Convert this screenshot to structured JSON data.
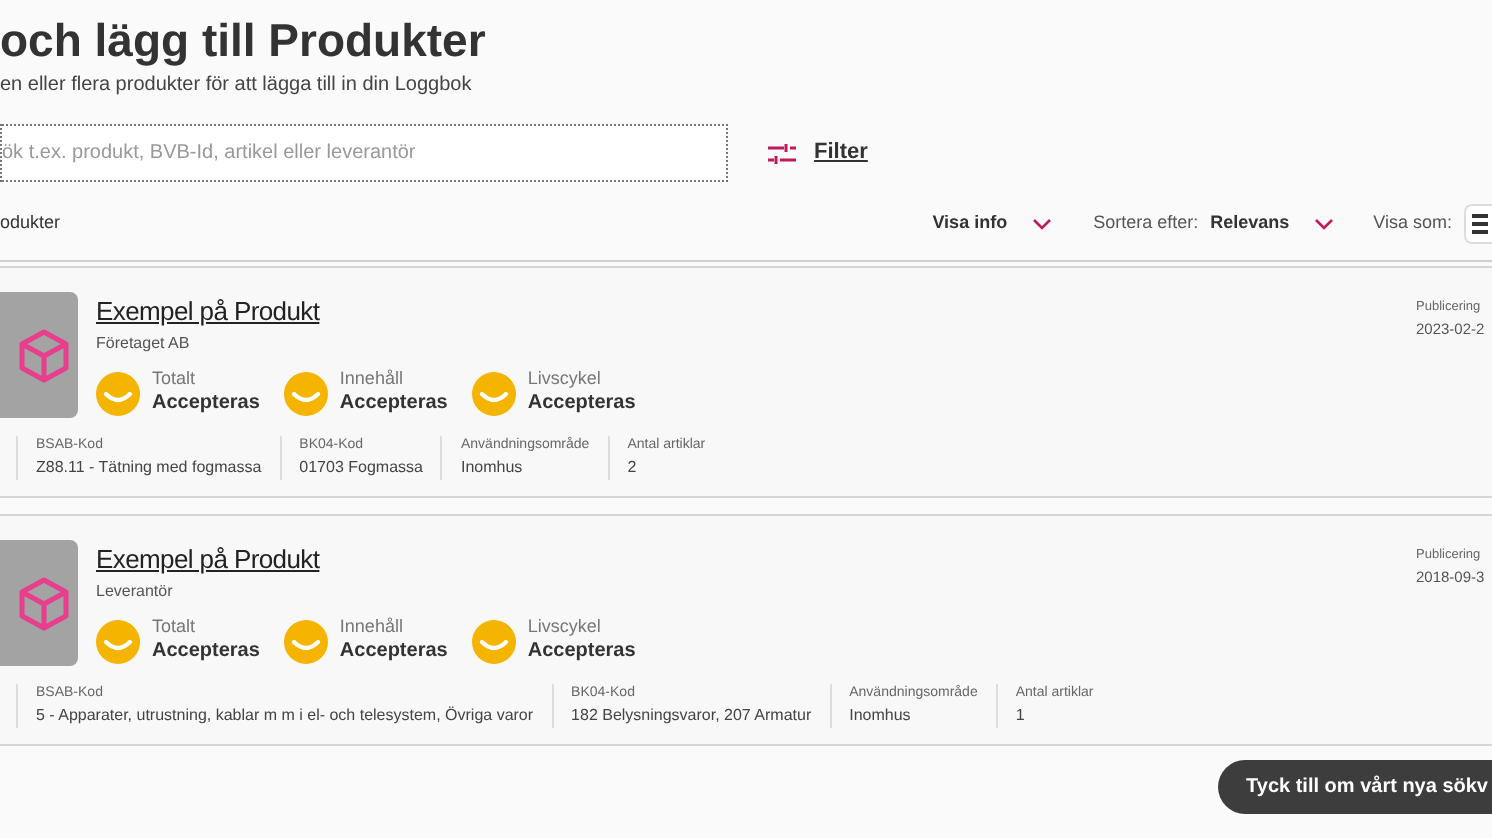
{
  "header": {
    "title": "och lägg till Produkter",
    "subtitle": "en eller flera produkter för att lägga till in din Loggbok"
  },
  "search": {
    "placeholder": "ök t.ex. produkt, BVB-Id, artikel eller leverantör",
    "filter_label": "Filter"
  },
  "toolbar": {
    "count_label": "odukter",
    "visa_info": "Visa info",
    "sort_label": "Sortera efter:",
    "sort_value": "Relevans",
    "view_label": "Visa som:"
  },
  "products": [
    {
      "name": "Exempel på Produkt",
      "supplier": "Företaget AB",
      "published_label": "Publicering",
      "published_date": "2023-02-2",
      "ratings": [
        {
          "label": "Totalt",
          "value": "Accepteras"
        },
        {
          "label": "Innehåll",
          "value": "Accepteras"
        },
        {
          "label": "Livscykel",
          "value": "Accepteras"
        }
      ],
      "fields": [
        {
          "label": "BSAB-Kod",
          "value": "Z88.11 - Tätning med fogmassa"
        },
        {
          "label": "BK04-Kod",
          "value": "01703 Fogmassa"
        },
        {
          "label": "Användningsområde",
          "value": "Inomhus"
        },
        {
          "label": "Antal artiklar",
          "value": "2"
        }
      ]
    },
    {
      "name": "Exempel på Produkt",
      "supplier": "Leverantör",
      "published_label": "Publicering",
      "published_date": "2018-09-3",
      "ratings": [
        {
          "label": "Totalt",
          "value": "Accepteras"
        },
        {
          "label": "Innehåll",
          "value": "Accepteras"
        },
        {
          "label": "Livscykel",
          "value": "Accepteras"
        }
      ],
      "fields": [
        {
          "label": "BSAB-Kod",
          "value": "5 - Apparater, utrustning, kablar m m i el- och telesystem, Övriga varor"
        },
        {
          "label": "BK04-Kod",
          "value": "182 Belysningsvaror, 207 Armatur"
        },
        {
          "label": "Användningsområde",
          "value": "Inomhus"
        },
        {
          "label": "Antal artiklar",
          "value": "1"
        }
      ]
    }
  ],
  "feedback_button": "Tyck till om vårt nya sökv"
}
